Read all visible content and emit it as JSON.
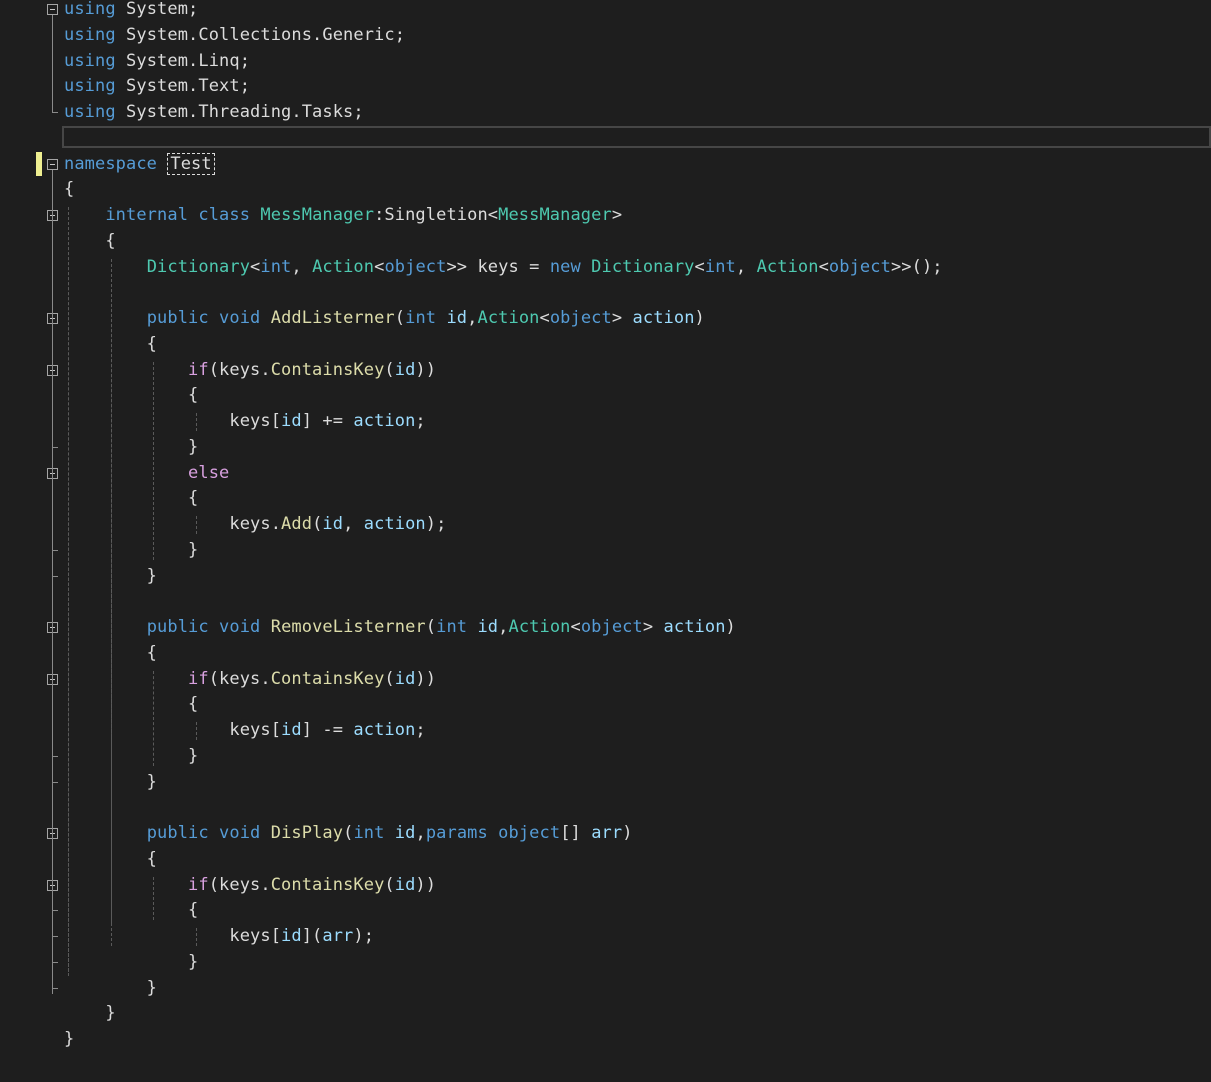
{
  "editor": {
    "language": "csharp",
    "colors": {
      "background": "#1e1e1e",
      "keyword": "#569cd6",
      "control_keyword": "#d8a0df",
      "type": "#4ec9b0",
      "method": "#dcdcaa",
      "parameter": "#9cdcfe",
      "plain": "#dcdcdc",
      "change_marker": "#efef91"
    },
    "lines": [
      [
        {
          "t": "using",
          "c": "kw"
        },
        {
          "t": " System;",
          "c": "plain"
        }
      ],
      [
        {
          "t": "using",
          "c": "kw"
        },
        {
          "t": " System.Collections.Generic;",
          "c": "plain"
        }
      ],
      [
        {
          "t": "using",
          "c": "kw"
        },
        {
          "t": " System.Linq;",
          "c": "plain"
        }
      ],
      [
        {
          "t": "using",
          "c": "kw"
        },
        {
          "t": " System.Text;",
          "c": "plain"
        }
      ],
      [
        {
          "t": "using",
          "c": "kw"
        },
        {
          "t": " System.Threading.Tasks;",
          "c": "plain"
        }
      ],
      [],
      [
        {
          "t": "namespace",
          "c": "kw"
        },
        {
          "t": " ",
          "c": "plain"
        },
        {
          "t": "Test",
          "c": "ns"
        }
      ],
      [
        {
          "t": "{",
          "c": "plain"
        }
      ],
      [
        {
          "t": "    ",
          "c": "plain"
        },
        {
          "t": "internal",
          "c": "kw"
        },
        {
          "t": " ",
          "c": "plain"
        },
        {
          "t": "class",
          "c": "kw"
        },
        {
          "t": " ",
          "c": "plain"
        },
        {
          "t": "MessManager",
          "c": "type"
        },
        {
          "t": ":Singletion<",
          "c": "plain"
        },
        {
          "t": "MessManager",
          "c": "type"
        },
        {
          "t": ">",
          "c": "plain"
        }
      ],
      [
        {
          "t": "    {",
          "c": "plain"
        }
      ],
      [
        {
          "t": "        ",
          "c": "plain"
        },
        {
          "t": "Dictionary",
          "c": "type"
        },
        {
          "t": "<",
          "c": "plain"
        },
        {
          "t": "int",
          "c": "kw"
        },
        {
          "t": ", ",
          "c": "plain"
        },
        {
          "t": "Action",
          "c": "type"
        },
        {
          "t": "<",
          "c": "plain"
        },
        {
          "t": "object",
          "c": "kw"
        },
        {
          "t": ">> keys = ",
          "c": "plain"
        },
        {
          "t": "new",
          "c": "kw"
        },
        {
          "t": " ",
          "c": "plain"
        },
        {
          "t": "Dictionary",
          "c": "type"
        },
        {
          "t": "<",
          "c": "plain"
        },
        {
          "t": "int",
          "c": "kw"
        },
        {
          "t": ", ",
          "c": "plain"
        },
        {
          "t": "Action",
          "c": "type"
        },
        {
          "t": "<",
          "c": "plain"
        },
        {
          "t": "object",
          "c": "kw"
        },
        {
          "t": ">>();",
          "c": "plain"
        }
      ],
      [],
      [
        {
          "t": "        ",
          "c": "plain"
        },
        {
          "t": "public",
          "c": "kw"
        },
        {
          "t": " ",
          "c": "plain"
        },
        {
          "t": "void",
          "c": "kw"
        },
        {
          "t": " ",
          "c": "plain"
        },
        {
          "t": "AddListerner",
          "c": "fn"
        },
        {
          "t": "(",
          "c": "plain"
        },
        {
          "t": "int",
          "c": "kw"
        },
        {
          "t": " ",
          "c": "plain"
        },
        {
          "t": "id",
          "c": "var"
        },
        {
          "t": ",",
          "c": "plain"
        },
        {
          "t": "Action",
          "c": "type"
        },
        {
          "t": "<",
          "c": "plain"
        },
        {
          "t": "object",
          "c": "kw"
        },
        {
          "t": "> ",
          "c": "plain"
        },
        {
          "t": "action",
          "c": "var"
        },
        {
          "t": ")",
          "c": "plain"
        }
      ],
      [
        {
          "t": "        {",
          "c": "plain"
        }
      ],
      [
        {
          "t": "            ",
          "c": "plain"
        },
        {
          "t": "if",
          "c": "ctl"
        },
        {
          "t": "(keys.",
          "c": "plain"
        },
        {
          "t": "ContainsKey",
          "c": "fn"
        },
        {
          "t": "(",
          "c": "plain"
        },
        {
          "t": "id",
          "c": "var"
        },
        {
          "t": "))",
          "c": "plain"
        }
      ],
      [
        {
          "t": "            {",
          "c": "plain"
        }
      ],
      [
        {
          "t": "                keys[",
          "c": "plain"
        },
        {
          "t": "id",
          "c": "var"
        },
        {
          "t": "] += ",
          "c": "plain"
        },
        {
          "t": "action",
          "c": "var"
        },
        {
          "t": ";",
          "c": "plain"
        }
      ],
      [
        {
          "t": "            }",
          "c": "plain"
        }
      ],
      [
        {
          "t": "            ",
          "c": "plain"
        },
        {
          "t": "else",
          "c": "ctl"
        }
      ],
      [
        {
          "t": "            {",
          "c": "plain"
        }
      ],
      [
        {
          "t": "                keys.",
          "c": "plain"
        },
        {
          "t": "Add",
          "c": "fn"
        },
        {
          "t": "(",
          "c": "plain"
        },
        {
          "t": "id",
          "c": "var"
        },
        {
          "t": ", ",
          "c": "plain"
        },
        {
          "t": "action",
          "c": "var"
        },
        {
          "t": ");",
          "c": "plain"
        }
      ],
      [
        {
          "t": "            }",
          "c": "plain"
        }
      ],
      [
        {
          "t": "        }",
          "c": "plain"
        }
      ],
      [],
      [
        {
          "t": "        ",
          "c": "plain"
        },
        {
          "t": "public",
          "c": "kw"
        },
        {
          "t": " ",
          "c": "plain"
        },
        {
          "t": "void",
          "c": "kw"
        },
        {
          "t": " ",
          "c": "plain"
        },
        {
          "t": "RemoveListerner",
          "c": "fn"
        },
        {
          "t": "(",
          "c": "plain"
        },
        {
          "t": "int",
          "c": "kw"
        },
        {
          "t": " ",
          "c": "plain"
        },
        {
          "t": "id",
          "c": "var"
        },
        {
          "t": ",",
          "c": "plain"
        },
        {
          "t": "Action",
          "c": "type"
        },
        {
          "t": "<",
          "c": "plain"
        },
        {
          "t": "object",
          "c": "kw"
        },
        {
          "t": "> ",
          "c": "plain"
        },
        {
          "t": "action",
          "c": "var"
        },
        {
          "t": ")",
          "c": "plain"
        }
      ],
      [
        {
          "t": "        {",
          "c": "plain"
        }
      ],
      [
        {
          "t": "            ",
          "c": "plain"
        },
        {
          "t": "if",
          "c": "ctl"
        },
        {
          "t": "(keys.",
          "c": "plain"
        },
        {
          "t": "ContainsKey",
          "c": "fn"
        },
        {
          "t": "(",
          "c": "plain"
        },
        {
          "t": "id",
          "c": "var"
        },
        {
          "t": "))",
          "c": "plain"
        }
      ],
      [
        {
          "t": "            {",
          "c": "plain"
        }
      ],
      [
        {
          "t": "                keys[",
          "c": "plain"
        },
        {
          "t": "id",
          "c": "var"
        },
        {
          "t": "] -= ",
          "c": "plain"
        },
        {
          "t": "action",
          "c": "var"
        },
        {
          "t": ";",
          "c": "plain"
        }
      ],
      [
        {
          "t": "            }",
          "c": "plain"
        }
      ],
      [
        {
          "t": "        }",
          "c": "plain"
        }
      ],
      [],
      [
        {
          "t": "        ",
          "c": "plain"
        },
        {
          "t": "public",
          "c": "kw"
        },
        {
          "t": " ",
          "c": "plain"
        },
        {
          "t": "void",
          "c": "kw"
        },
        {
          "t": " ",
          "c": "plain"
        },
        {
          "t": "DisPlay",
          "c": "fn"
        },
        {
          "t": "(",
          "c": "plain"
        },
        {
          "t": "int",
          "c": "kw"
        },
        {
          "t": " ",
          "c": "plain"
        },
        {
          "t": "id",
          "c": "var"
        },
        {
          "t": ",",
          "c": "plain"
        },
        {
          "t": "params",
          "c": "kw"
        },
        {
          "t": " ",
          "c": "plain"
        },
        {
          "t": "object",
          "c": "kw"
        },
        {
          "t": "[] ",
          "c": "plain"
        },
        {
          "t": "arr",
          "c": "var"
        },
        {
          "t": ")",
          "c": "plain"
        }
      ],
      [
        {
          "t": "        {",
          "c": "plain"
        }
      ],
      [
        {
          "t": "            ",
          "c": "plain"
        },
        {
          "t": "if",
          "c": "ctl"
        },
        {
          "t": "(keys.",
          "c": "plain"
        },
        {
          "t": "ContainsKey",
          "c": "fn"
        },
        {
          "t": "(",
          "c": "plain"
        },
        {
          "t": "id",
          "c": "var"
        },
        {
          "t": "))",
          "c": "plain"
        }
      ],
      [
        {
          "t": "            {",
          "c": "plain"
        }
      ],
      [
        {
          "t": "                keys[",
          "c": "plain"
        },
        {
          "t": "id",
          "c": "var"
        },
        {
          "t": "](",
          "c": "plain"
        },
        {
          "t": "arr",
          "c": "var"
        },
        {
          "t": ");",
          "c": "plain"
        }
      ],
      [
        {
          "t": "            }",
          "c": "plain"
        }
      ],
      [
        {
          "t": "        }",
          "c": "plain"
        }
      ],
      [
        {
          "t": "    }",
          "c": "plain"
        }
      ],
      [
        {
          "t": "}",
          "c": "plain"
        }
      ]
    ],
    "fold_lines": [
      0,
      6,
      8,
      12,
      14,
      18,
      24,
      26,
      32,
      34
    ],
    "current_line": 5,
    "modified_line": 6
  }
}
